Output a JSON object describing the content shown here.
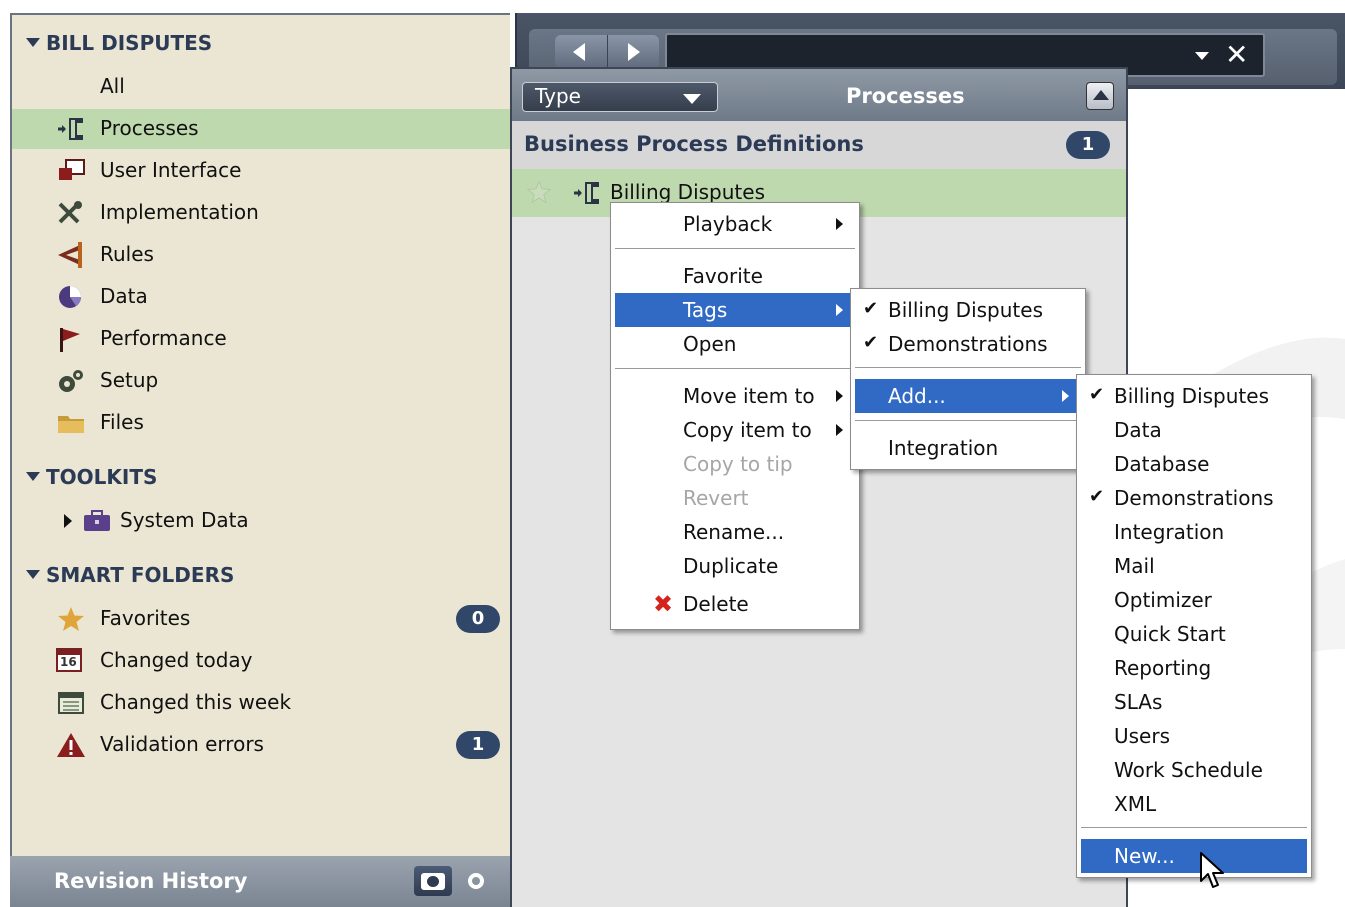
{
  "sidebar": {
    "sections": {
      "bill_disputes": "BILL DISPUTES",
      "toolkits": "TOOLKITS",
      "smart_folders": "SMART FOLDERS"
    },
    "items": {
      "all": "All",
      "processes": "Processes",
      "user_interface": "User Interface",
      "implementation": "Implementation",
      "rules": "Rules",
      "data": "Data",
      "performance": "Performance",
      "setup": "Setup",
      "files": "Files"
    },
    "toolkits": {
      "system_data": "System Data"
    },
    "smart_folders": {
      "favorites": "Favorites",
      "favorites_count": "0",
      "changed_today": "Changed today",
      "changed_this_week": "Changed this week",
      "validation_errors": "Validation errors",
      "validation_errors_count": "1"
    },
    "revision_history": "Revision History",
    "calendar_day": "16"
  },
  "processes_panel": {
    "type_dropdown": "Type",
    "title": "Processes",
    "group_label": "Business Process Definitions",
    "group_count": "1",
    "item": "Billing Disputes"
  },
  "context_menu": {
    "playback": "Playback",
    "favorite": "Favorite",
    "tags": "Tags",
    "open": "Open",
    "move_item_to": "Move item to",
    "copy_item_to": "Copy item to",
    "copy_to_tip": "Copy to tip",
    "revert": "Revert",
    "rename": "Rename...",
    "duplicate": "Duplicate",
    "delete": "Delete"
  },
  "tags_menu": {
    "billing_disputes": "Billing Disputes",
    "demonstrations": "Demonstrations",
    "add": "Add...",
    "integration": "Integration"
  },
  "add_menu": {
    "items": [
      "Billing Disputes",
      "Data",
      "Database",
      "Demonstrations",
      "Integration",
      "Mail",
      "Optimizer",
      "Quick Start",
      "Reporting",
      "SLAs",
      "Users",
      "Work Schedule",
      "XML"
    ],
    "checked": [
      "Billing Disputes",
      "Demonstrations"
    ],
    "new": "New..."
  },
  "colors": {
    "selection": "#316ac5",
    "selected_row": "#bfd9ae",
    "badge": "#31476a",
    "sidebar_bg": "#ebe6d3"
  }
}
